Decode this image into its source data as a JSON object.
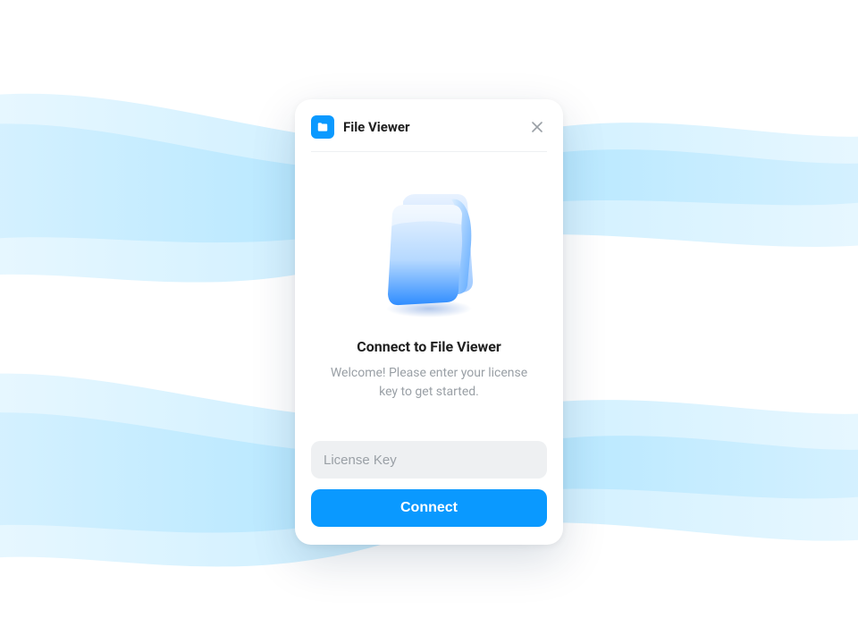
{
  "header": {
    "app_title": "File Viewer"
  },
  "hero": {
    "heading": "Connect to File Viewer",
    "subtext": "Welcome! Please enter your license key to get started."
  },
  "form": {
    "license_placeholder": "License Key",
    "license_value": "",
    "connect_label": "Connect"
  },
  "colors": {
    "accent": "#0a99ff",
    "muted_text": "#9aa0a6"
  }
}
